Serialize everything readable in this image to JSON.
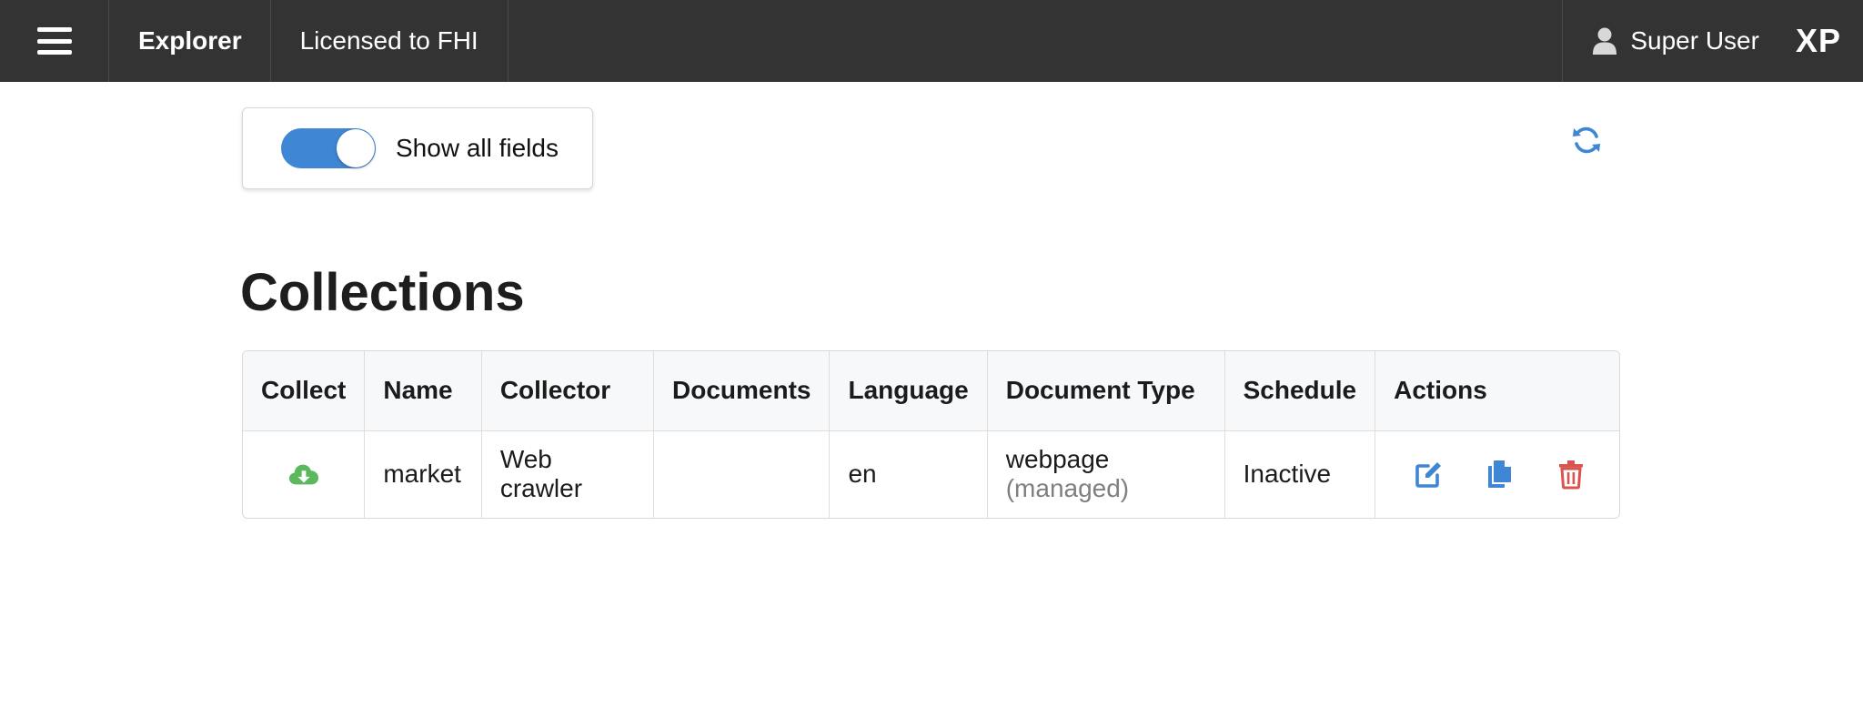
{
  "topbar": {
    "nav": [
      {
        "label": "Explorer"
      },
      {
        "label": "Licensed to FHI"
      }
    ],
    "user_name": "Super User",
    "brand": "XP"
  },
  "toolbar": {
    "show_all_fields_label": "Show all fields",
    "show_all_fields_on": true
  },
  "page": {
    "title": "Collections"
  },
  "table": {
    "headers": {
      "collect": "Collect",
      "name": "Name",
      "collector": "Collector",
      "documents": "Documents",
      "language": "Language",
      "document_type": "Document Type",
      "schedule": "Schedule",
      "actions": "Actions"
    },
    "rows": [
      {
        "name": "market",
        "collector": "Web crawler",
        "documents": "",
        "language": "en",
        "document_type": "webpage",
        "document_type_note": "(managed)",
        "schedule": "Inactive"
      }
    ]
  },
  "icons": {
    "menu": "menu-icon",
    "user": "user-icon",
    "refresh": "refresh-icon",
    "collect": "cloud-download-icon",
    "edit": "edit-icon",
    "copy": "copy-icon",
    "delete": "trash-icon"
  },
  "colors": {
    "topbar_bg": "#333333",
    "accent": "#3f86d4",
    "collect_green": "#5cb85c",
    "delete_red": "#d9534f"
  }
}
